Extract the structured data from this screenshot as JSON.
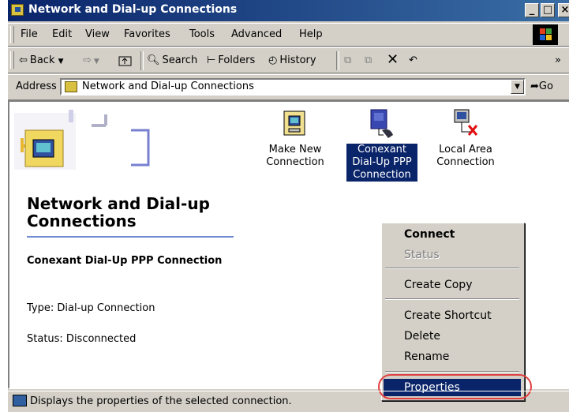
{
  "window": {
    "title": "Network and Dial-up Connections"
  },
  "title_buttons": {
    "minimize": "_",
    "maximize": "□",
    "close": "×"
  },
  "menu": [
    "File",
    "Edit",
    "View",
    "Favorites",
    "Tools",
    "Advanced",
    "Help"
  ],
  "toolbar": {
    "back": "Back",
    "back_icon": "⇦",
    "forward_icon": "⇨",
    "search": "Search",
    "folders": "Folders",
    "history": "History",
    "overflow": "»"
  },
  "address": {
    "label": "Address",
    "value": "Network and Dial-up Connections",
    "go": "Go"
  },
  "panel": {
    "heading": "Network and Dial-up Connections",
    "selected_name": "Conexant Dial-Up PPP Connection",
    "type": "Type: Dial-up Connection",
    "status": "Status: Disconnected"
  },
  "items": [
    {
      "label": "Make New Connection",
      "selected": false,
      "icon": "make-new-connection-icon"
    },
    {
      "label": "Conexant Dial-Up PPP Connection",
      "selected": true,
      "icon": "dialup-connection-icon"
    },
    {
      "label": "Local Area Connection",
      "selected": false,
      "icon": "lan-disconnected-icon"
    }
  ],
  "context_menu": {
    "connect": "Connect",
    "status": "Status",
    "create_copy": "Create Copy",
    "create_shortcut": "Create Shortcut",
    "delete": "Delete",
    "rename": "Rename",
    "properties": "Properties"
  },
  "statusbar": {
    "text": "Displays the properties of the selected connection."
  },
  "colors": {
    "selection": "#0a246a",
    "highlight_circle": "#e04040",
    "titlebar": "#0a246a"
  }
}
